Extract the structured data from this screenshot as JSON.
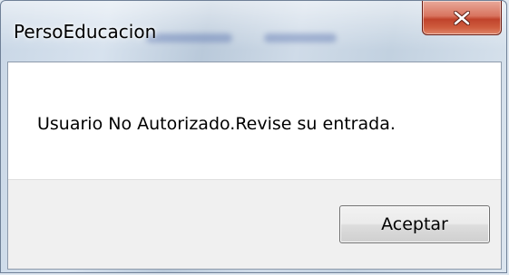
{
  "window": {
    "title": "PersoEducacion",
    "close_icon": "close-icon",
    "close_color": "#c7452d"
  },
  "dialog": {
    "message": "Usuario No Autorizado.Revise su entrada.",
    "ok_label": "Aceptar"
  }
}
